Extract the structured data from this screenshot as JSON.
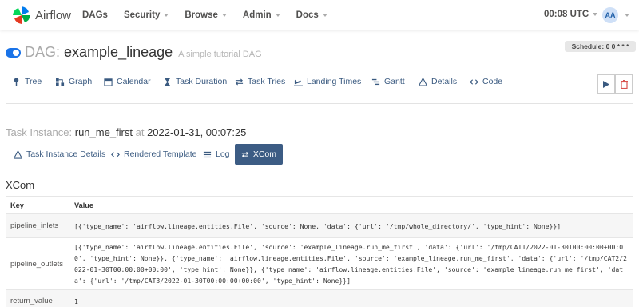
{
  "navbar": {
    "brand": "Airflow",
    "menu": [
      {
        "label": "DAGs",
        "caret": false
      },
      {
        "label": "Security",
        "caret": true
      },
      {
        "label": "Browse",
        "caret": true
      },
      {
        "label": "Admin",
        "caret": true
      },
      {
        "label": "Docs",
        "caret": true
      }
    ],
    "time": "00:08 UTC",
    "user_initials": "AA"
  },
  "dag": {
    "label": "DAG:",
    "id": "example_lineage",
    "description": "A simple tutorial DAG",
    "schedule": "Schedule: 0 0 * * *",
    "toggle_on": true
  },
  "dag_tabs": [
    "Tree",
    "Graph",
    "Calendar",
    "Task Duration",
    "Task Tries",
    "Landing Times",
    "Gantt",
    "Details",
    "Code"
  ],
  "task_instance": {
    "label": "Task Instance:",
    "task_id": "run_me_first",
    "at": "at",
    "date": "2022-01-31, 00:07:25"
  },
  "ti_tabs": [
    {
      "label": "Task Instance Details",
      "icon": "alert-triangle-icon"
    },
    {
      "label": "Rendered Template",
      "icon": "code-icon"
    },
    {
      "label": "Log",
      "icon": "list-icon"
    },
    {
      "label": "XCom",
      "icon": "arrows-exchange-icon",
      "active": true
    }
  ],
  "xcom": {
    "title": "XCom",
    "columns": [
      "Key",
      "Value"
    ],
    "rows": [
      {
        "key": "pipeline_inlets",
        "value": "[{'type_name': 'airflow.lineage.entities.File', 'source': None, 'data': {'url': '/tmp/whole_directory/', 'type_hint': None}}]"
      },
      {
        "key": "pipeline_outlets",
        "value": "[{'type_name': 'airflow.lineage.entities.File', 'source': 'example_lineage.run_me_first', 'data': {'url': '/tmp/CAT1/2022-01-30T00:00:00+00:00', 'type_hint': None}}, {'type_name': 'airflow.lineage.entities.File', 'source': 'example_lineage.run_me_first', 'data': {'url': '/tmp/CAT2/2022-01-30T00:00:00+00:00', 'type_hint': None}}, {'type_name': 'airflow.lineage.entities.File', 'source': 'example_lineage.run_me_first', 'data': {'url': '/tmp/CAT3/2022-01-30T00:00:00+00:00', 'type_hint': None}}]"
      },
      {
        "key": "return_value",
        "value": "1"
      }
    ]
  },
  "colors": {
    "accent": "#1a73e8",
    "link": "#3a5a80",
    "active_tab": "#3c5c84",
    "delete": "#d9534f"
  }
}
